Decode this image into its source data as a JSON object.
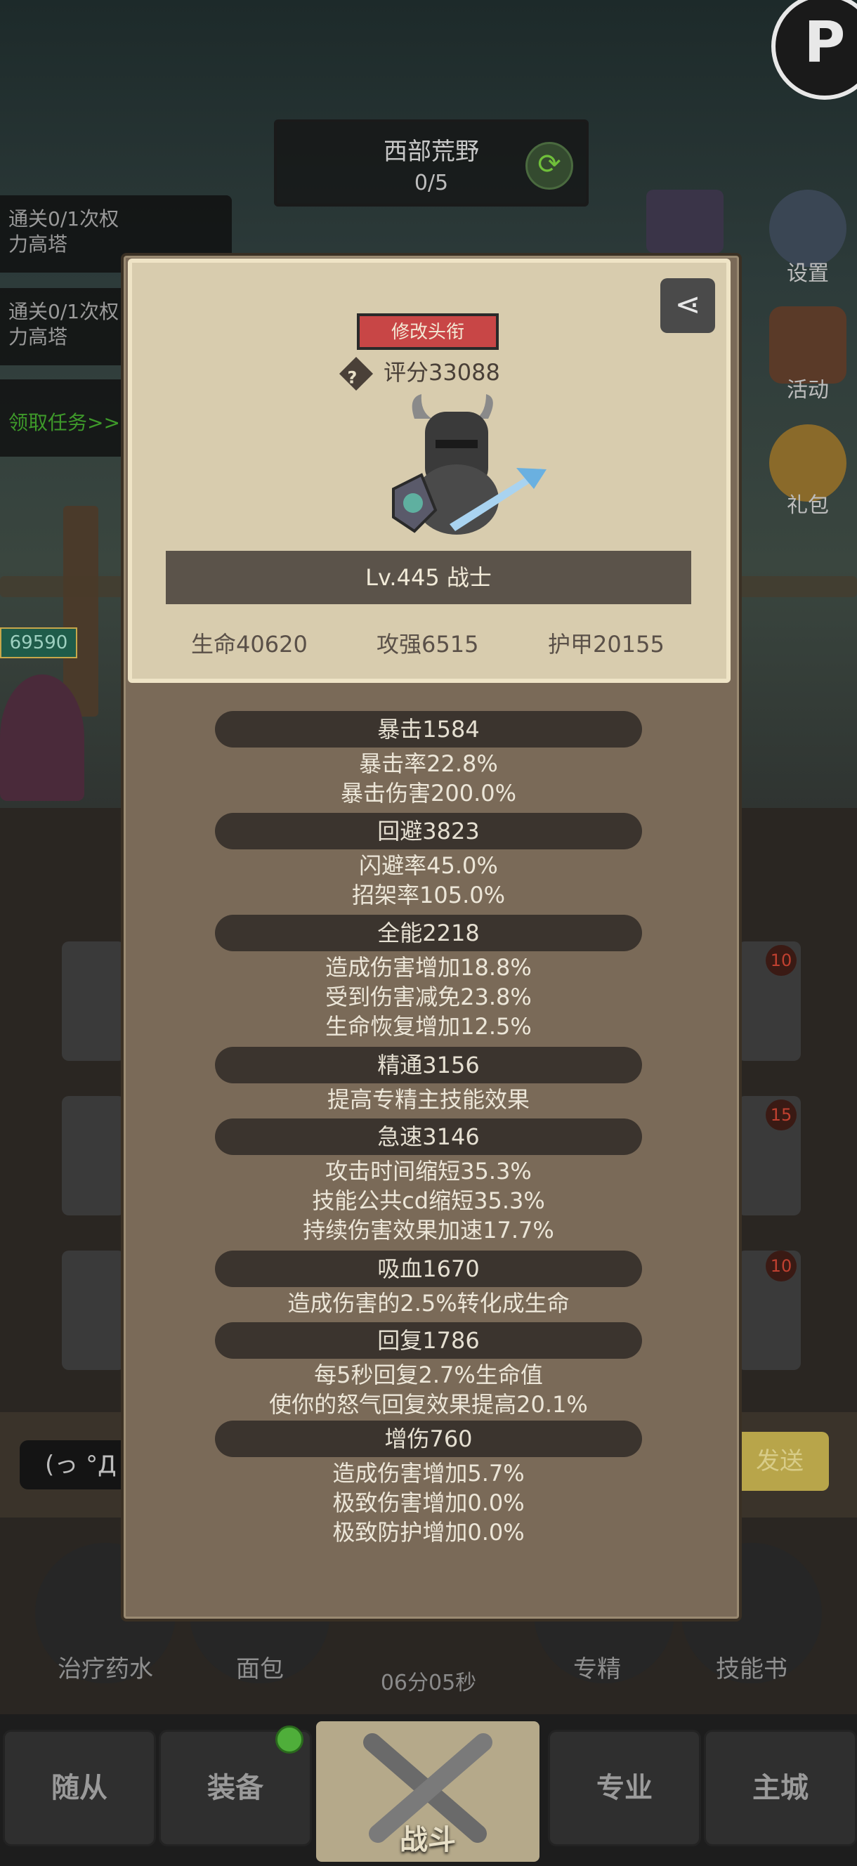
{
  "zone": {
    "name": "西部荒野",
    "progress": "0/5"
  },
  "quests": [
    {
      "text_line1": "通关0/1次权",
      "text_line2": "力高塔"
    },
    {
      "text_line1": "通关0/1次权",
      "text_line2": "力高塔"
    }
  ],
  "quest_claim": "领取任务>>",
  "hp_tag": "69590",
  "right_menu": {
    "settings": "设置",
    "events": "活动",
    "gifts": "礼包"
  },
  "chat": {
    "input_emote": "(っ °Д °",
    "send_label": "发送"
  },
  "consumables": {
    "potion": "治疗药水",
    "bread": "面包",
    "mastery": "专精",
    "skillbook": "技能书",
    "timer": "06分05秒"
  },
  "slot_levels": [
    "10",
    "15",
    "10"
  ],
  "nav": {
    "followers": "随从",
    "equipment": "装备",
    "battle": "战斗",
    "profession": "专业",
    "main_city": "主城"
  },
  "profile": {
    "edit_title": "修改头衔",
    "score": "评分33088",
    "level_class": "Lv.445 战士",
    "hp": "生命40620",
    "attack": "攻强6515",
    "armor": "护甲20155"
  },
  "stats": [
    {
      "header": "暴击1584",
      "lines": [
        "暴击率22.8%",
        "暴击伤害200.0%"
      ]
    },
    {
      "header": "回避3823",
      "lines": [
        "闪避率45.0%",
        "招架率105.0%"
      ]
    },
    {
      "header": "全能2218",
      "lines": [
        "造成伤害增加18.8%",
        "受到伤害减免23.8%",
        "生命恢复增加12.5%"
      ]
    },
    {
      "header": "精通3156",
      "lines": [
        "提高专精主技能效果"
      ]
    },
    {
      "header": "急速3146",
      "lines": [
        "攻击时间缩短35.3%",
        "技能公共cd缩短35.3%",
        "持续伤害效果加速17.7%"
      ]
    },
    {
      "header": "吸血1670",
      "lines": [
        "造成伤害的2.5%转化成生命"
      ]
    },
    {
      "header": "回复1786",
      "lines": [
        "每5秒回复2.7%生命值",
        "使你的怒气回复效果提高20.1%"
      ]
    },
    {
      "header": "增伤760",
      "lines": [
        "造成伤害增加5.7%",
        "极致伤害增加0.0%",
        "极致防护增加0.0%"
      ]
    }
  ]
}
